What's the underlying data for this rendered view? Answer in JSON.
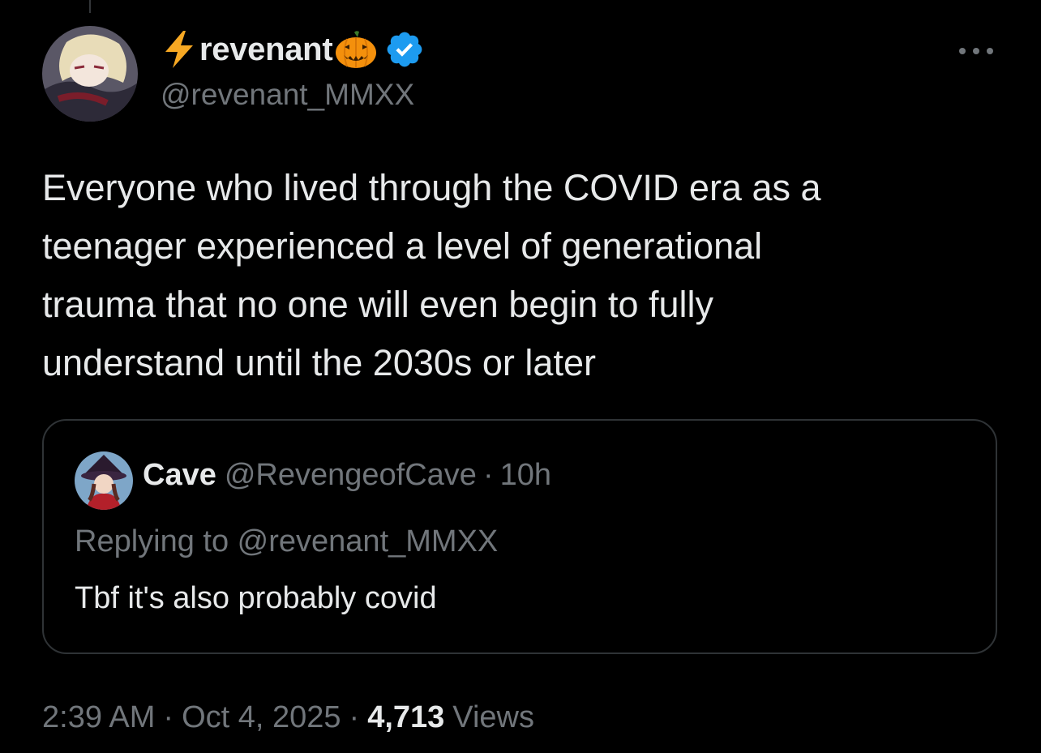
{
  "tweet": {
    "author": {
      "display_name": "revenant",
      "handle": "@revenant_MMXX",
      "verified": true,
      "name_emojis": [
        "lightning-icon",
        "pumpkin-icon"
      ]
    },
    "text": "Everyone who lived through the COVID era as a\nteenager experienced a level of generational\ntrauma that no one will even begin to fully\nunderstand until the 2030s or later",
    "quote": {
      "name": "Cave",
      "handle": "@RevengeofCave",
      "separator": "·",
      "time": "10h",
      "replying_to": "Replying to @revenant_MMXX",
      "text": "Tbf it's also probably covid"
    },
    "meta": {
      "time": "2:39 AM",
      "separator": "·",
      "date": "Oct 4, 2025",
      "views_count": "4,713",
      "views_label": "Views"
    }
  },
  "colors": {
    "background": "#000000",
    "primary_text": "#e7e9ea",
    "secondary_text": "#71767b",
    "border": "#2f3336",
    "verified_blue": "#1d9bf0",
    "lightning": "#f7a823",
    "pumpkin": "#f4900c"
  }
}
